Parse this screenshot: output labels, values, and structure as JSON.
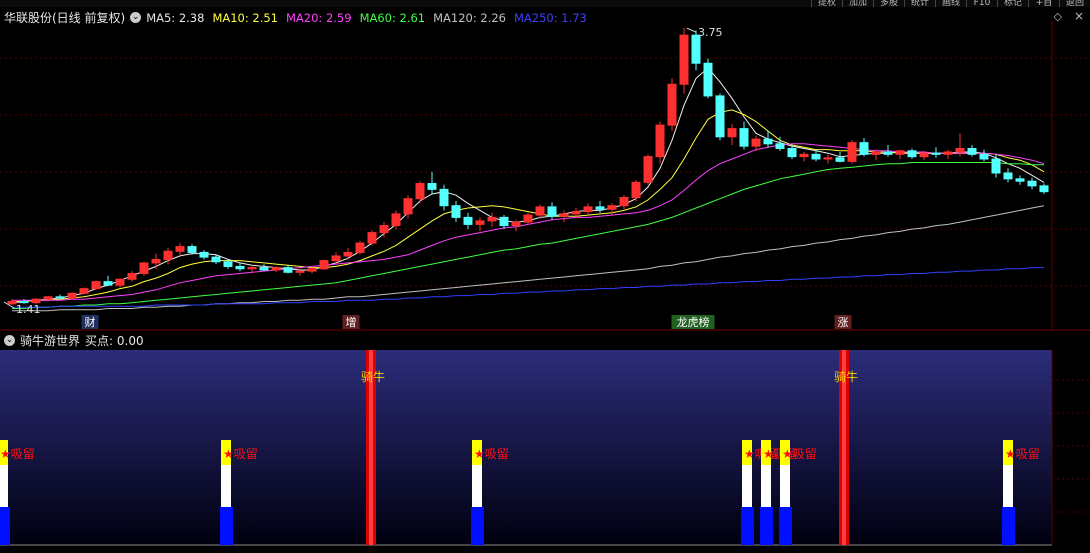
{
  "window": {
    "top_tabs_right": [
      "提权",
      "加加",
      "多股",
      "统计",
      "画线",
      "F10",
      "标记",
      "+自",
      "返回"
    ]
  },
  "main_panel": {
    "title": "华联股份(日线 前复权)",
    "ma_indicators": [
      {
        "label": "MA5: 2.38",
        "color": "#e6e6e6"
      },
      {
        "label": "MA10: 2.51",
        "color": "#ffff40"
      },
      {
        "label": "MA20: 2.59",
        "color": "#ff40ff"
      },
      {
        "label": "MA60: 2.61",
        "color": "#40ff40"
      },
      {
        "label": "MA120: 2.26",
        "color": "#c0c0c0"
      },
      {
        "label": "MA250: 1.73",
        "color": "#4040ff"
      }
    ],
    "high_label": "3.75",
    "low_label": "1.41",
    "date_markers": [
      {
        "text": "财",
        "color": "#ffffff",
        "bg": "#203060"
      },
      {
        "text": "增",
        "color": "#ffffff",
        "bg": "#602020"
      },
      {
        "text": "龙虎榜",
        "color": "#ffffff",
        "bg": "#206020"
      },
      {
        "text": "涨",
        "color": "#ffffff",
        "bg": "#602020"
      }
    ]
  },
  "sub_panel": {
    "title": "骑牛游世界",
    "buy_label": "买点: 0.00",
    "signal_bull": "骑牛",
    "signal_absorb": "★吸留",
    "colors": {
      "background_top": "#2c2c7a",
      "background_bottom": "#000010",
      "bull_bar": "#e00000",
      "absorb_yellow": "#ffff00",
      "absorb_white": "#ffffff",
      "absorb_blue": "#0010ff",
      "text": "#ff1010"
    }
  },
  "chart_data": {
    "type": "candlestick",
    "y_range": [
      1.35,
      3.85
    ],
    "ohlc": [
      [
        1.42,
        1.46,
        1.41,
        1.44
      ],
      [
        1.44,
        1.46,
        1.42,
        1.43
      ],
      [
        1.43,
        1.47,
        1.42,
        1.46
      ],
      [
        1.46,
        1.49,
        1.44,
        1.48
      ],
      [
        1.48,
        1.5,
        1.46,
        1.47
      ],
      [
        1.47,
        1.52,
        1.46,
        1.51
      ],
      [
        1.51,
        1.56,
        1.5,
        1.55
      ],
      [
        1.55,
        1.62,
        1.54,
        1.61
      ],
      [
        1.61,
        1.66,
        1.57,
        1.58
      ],
      [
        1.58,
        1.64,
        1.56,
        1.63
      ],
      [
        1.63,
        1.7,
        1.61,
        1.68
      ],
      [
        1.68,
        1.78,
        1.66,
        1.77
      ],
      [
        1.77,
        1.85,
        1.72,
        1.8
      ],
      [
        1.8,
        1.9,
        1.76,
        1.87
      ],
      [
        1.87,
        1.94,
        1.83,
        1.91
      ],
      [
        1.91,
        1.93,
        1.84,
        1.86
      ],
      [
        1.86,
        1.88,
        1.8,
        1.82
      ],
      [
        1.82,
        1.84,
        1.76,
        1.78
      ],
      [
        1.78,
        1.8,
        1.72,
        1.74
      ],
      [
        1.74,
        1.77,
        1.7,
        1.72
      ],
      [
        1.72,
        1.75,
        1.68,
        1.73
      ],
      [
        1.73,
        1.76,
        1.7,
        1.71
      ],
      [
        1.71,
        1.74,
        1.69,
        1.73
      ],
      [
        1.73,
        1.75,
        1.68,
        1.69
      ],
      [
        1.69,
        1.72,
        1.66,
        1.7
      ],
      [
        1.7,
        1.74,
        1.68,
        1.72
      ],
      [
        1.72,
        1.8,
        1.71,
        1.79
      ],
      [
        1.79,
        1.86,
        1.76,
        1.83
      ],
      [
        1.83,
        1.9,
        1.8,
        1.86
      ],
      [
        1.86,
        1.96,
        1.84,
        1.94
      ],
      [
        1.94,
        2.05,
        1.92,
        2.03
      ],
      [
        2.03,
        2.12,
        1.99,
        2.09
      ],
      [
        2.09,
        2.22,
        2.06,
        2.19
      ],
      [
        2.19,
        2.35,
        2.15,
        2.32
      ],
      [
        2.32,
        2.47,
        2.28,
        2.45
      ],
      [
        2.45,
        2.55,
        2.36,
        2.4
      ],
      [
        2.4,
        2.44,
        2.22,
        2.26
      ],
      [
        2.26,
        2.3,
        2.12,
        2.16
      ],
      [
        2.16,
        2.2,
        2.06,
        2.1
      ],
      [
        2.1,
        2.16,
        2.04,
        2.13
      ],
      [
        2.13,
        2.2,
        2.08,
        2.16
      ],
      [
        2.16,
        2.18,
        2.06,
        2.09
      ],
      [
        2.09,
        2.14,
        2.04,
        2.12
      ],
      [
        2.12,
        2.2,
        2.1,
        2.18
      ],
      [
        2.18,
        2.27,
        2.15,
        2.25
      ],
      [
        2.25,
        2.29,
        2.14,
        2.17
      ],
      [
        2.17,
        2.22,
        2.12,
        2.19
      ],
      [
        2.19,
        2.24,
        2.15,
        2.21
      ],
      [
        2.21,
        2.28,
        2.18,
        2.25
      ],
      [
        2.25,
        2.3,
        2.2,
        2.23
      ],
      [
        2.23,
        2.28,
        2.18,
        2.26
      ],
      [
        2.26,
        2.35,
        2.23,
        2.33
      ],
      [
        2.33,
        2.48,
        2.3,
        2.46
      ],
      [
        2.46,
        2.7,
        2.44,
        2.68
      ],
      [
        2.68,
        2.98,
        2.62,
        2.95
      ],
      [
        2.95,
        3.35,
        2.9,
        3.3
      ],
      [
        3.3,
        3.78,
        3.22,
        3.72
      ],
      [
        3.72,
        3.76,
        3.42,
        3.48
      ],
      [
        3.48,
        3.52,
        3.18,
        3.2
      ],
      [
        3.2,
        3.22,
        2.82,
        2.85
      ],
      [
        2.85,
        2.96,
        2.78,
        2.92
      ],
      [
        2.92,
        2.98,
        2.74,
        2.77
      ],
      [
        2.77,
        2.86,
        2.73,
        2.83
      ],
      [
        2.83,
        2.9,
        2.76,
        2.79
      ],
      [
        2.79,
        2.85,
        2.73,
        2.75
      ],
      [
        2.75,
        2.78,
        2.66,
        2.68
      ],
      [
        2.68,
        2.72,
        2.64,
        2.7
      ],
      [
        2.7,
        2.74,
        2.64,
        2.66
      ],
      [
        2.66,
        2.7,
        2.62,
        2.67
      ],
      [
        2.67,
        2.72,
        2.63,
        2.64
      ],
      [
        2.64,
        2.82,
        2.62,
        2.8
      ],
      [
        2.8,
        2.84,
        2.68,
        2.7
      ],
      [
        2.7,
        2.74,
        2.65,
        2.72
      ],
      [
        2.72,
        2.78,
        2.68,
        2.7
      ],
      [
        2.7,
        2.74,
        2.66,
        2.73
      ],
      [
        2.73,
        2.75,
        2.66,
        2.68
      ],
      [
        2.68,
        2.73,
        2.65,
        2.71
      ],
      [
        2.71,
        2.76,
        2.67,
        2.7
      ],
      [
        2.7,
        2.74,
        2.66,
        2.72
      ],
      [
        2.72,
        2.88,
        2.68,
        2.75
      ],
      [
        2.75,
        2.78,
        2.68,
        2.7
      ],
      [
        2.7,
        2.74,
        2.64,
        2.66
      ],
      [
        2.66,
        2.7,
        2.5,
        2.54
      ],
      [
        2.54,
        2.58,
        2.46,
        2.49
      ],
      [
        2.49,
        2.52,
        2.44,
        2.47
      ],
      [
        2.47,
        2.5,
        2.4,
        2.43
      ],
      [
        2.43,
        2.45,
        2.36,
        2.38
      ]
    ],
    "ma_series": [
      {
        "name": "MA5",
        "color": "#f0f0f0",
        "values": [
          1.43,
          1.44,
          1.45,
          1.46,
          1.47,
          1.49,
          1.51,
          1.55,
          1.58,
          1.62,
          1.66,
          1.7,
          1.74,
          1.79,
          1.83,
          1.85,
          1.85,
          1.84,
          1.8,
          1.77,
          1.75,
          1.74,
          1.73,
          1.72,
          1.71,
          1.71,
          1.74,
          1.77,
          1.81,
          1.87,
          1.94,
          2.02,
          2.1,
          2.2,
          2.3,
          2.36,
          2.38,
          2.35,
          2.28,
          2.22,
          2.16,
          2.13,
          2.12,
          2.13,
          2.16,
          2.17,
          2.19,
          2.21,
          2.22,
          2.22,
          2.24,
          2.27,
          2.32,
          2.42,
          2.58,
          2.82,
          3.12,
          3.35,
          3.44,
          3.32,
          3.18,
          3.02,
          2.88,
          2.83,
          2.8,
          2.77,
          2.75,
          2.73,
          2.71,
          2.68,
          2.69,
          2.7,
          2.71,
          2.71,
          2.72,
          2.71,
          2.71,
          2.71,
          2.71,
          2.72,
          2.72,
          2.71,
          2.67,
          2.62,
          2.58,
          2.52,
          2.46
        ]
      },
      {
        "name": "MA10",
        "color": "#ffff40",
        "values": [
          1.44,
          1.44,
          1.45,
          1.45,
          1.46,
          1.47,
          1.48,
          1.5,
          1.52,
          1.55,
          1.57,
          1.61,
          1.64,
          1.68,
          1.73,
          1.76,
          1.78,
          1.79,
          1.79,
          1.79,
          1.78,
          1.77,
          1.76,
          1.75,
          1.74,
          1.73,
          1.73,
          1.74,
          1.76,
          1.79,
          1.83,
          1.87,
          1.92,
          1.99,
          2.06,
          2.13,
          2.19,
          2.22,
          2.24,
          2.25,
          2.26,
          2.25,
          2.23,
          2.21,
          2.19,
          2.17,
          2.17,
          2.17,
          2.18,
          2.19,
          2.2,
          2.22,
          2.25,
          2.31,
          2.4,
          2.5,
          2.66,
          2.84,
          3.0,
          3.06,
          3.08,
          3.04,
          2.98,
          2.9,
          2.82,
          2.78,
          2.76,
          2.74,
          2.74,
          2.73,
          2.73,
          2.73,
          2.72,
          2.72,
          2.71,
          2.71,
          2.71,
          2.71,
          2.71,
          2.71,
          2.71,
          2.71,
          2.7,
          2.67,
          2.65,
          2.61,
          2.55
        ]
      },
      {
        "name": "MA20",
        "color": "#ff40ff",
        "values": [
          1.45,
          1.45,
          1.45,
          1.45,
          1.45,
          1.46,
          1.46,
          1.47,
          1.48,
          1.49,
          1.5,
          1.52,
          1.54,
          1.57,
          1.6,
          1.62,
          1.64,
          1.66,
          1.67,
          1.68,
          1.69,
          1.7,
          1.71,
          1.72,
          1.73,
          1.74,
          1.75,
          1.76,
          1.77,
          1.78,
          1.79,
          1.8,
          1.82,
          1.84,
          1.88,
          1.92,
          1.96,
          1.99,
          2.01,
          2.03,
          2.05,
          2.07,
          2.08,
          2.1,
          2.12,
          2.14,
          2.15,
          2.16,
          2.16,
          2.17,
          2.18,
          2.19,
          2.2,
          2.22,
          2.26,
          2.31,
          2.39,
          2.48,
          2.56,
          2.62,
          2.66,
          2.7,
          2.74,
          2.76,
          2.78,
          2.79,
          2.79,
          2.78,
          2.77,
          2.76,
          2.75,
          2.74,
          2.73,
          2.73,
          2.72,
          2.72,
          2.72,
          2.71,
          2.71,
          2.71,
          2.71,
          2.71,
          2.7,
          2.69,
          2.67,
          2.65,
          2.62
        ]
      },
      {
        "name": "MA60",
        "color": "#40ff40",
        "values": [
          1.38,
          1.38,
          1.39,
          1.39,
          1.4,
          1.4,
          1.41,
          1.41,
          1.42,
          1.42,
          1.43,
          1.44,
          1.45,
          1.46,
          1.47,
          1.48,
          1.49,
          1.5,
          1.51,
          1.52,
          1.53,
          1.54,
          1.55,
          1.56,
          1.57,
          1.58,
          1.59,
          1.6,
          1.62,
          1.64,
          1.66,
          1.68,
          1.7,
          1.72,
          1.74,
          1.76,
          1.78,
          1.8,
          1.82,
          1.84,
          1.86,
          1.88,
          1.89,
          1.91,
          1.93,
          1.94,
          1.96,
          1.98,
          2.0,
          2.02,
          2.04,
          2.06,
          2.08,
          2.1,
          2.13,
          2.16,
          2.2,
          2.24,
          2.28,
          2.32,
          2.36,
          2.4,
          2.43,
          2.46,
          2.49,
          2.51,
          2.53,
          2.55,
          2.57,
          2.58,
          2.59,
          2.6,
          2.61,
          2.62,
          2.62,
          2.63,
          2.63,
          2.63,
          2.63,
          2.63,
          2.63,
          2.63,
          2.63,
          2.62,
          2.62,
          2.61,
          2.61
        ]
      },
      {
        "name": "MA120",
        "color": "#c0c0c0",
        "values": [
          1.36,
          1.36,
          1.36,
          1.36,
          1.37,
          1.37,
          1.37,
          1.37,
          1.38,
          1.38,
          1.38,
          1.39,
          1.39,
          1.4,
          1.4,
          1.41,
          1.41,
          1.42,
          1.42,
          1.43,
          1.43,
          1.44,
          1.44,
          1.45,
          1.45,
          1.46,
          1.46,
          1.47,
          1.48,
          1.48,
          1.49,
          1.5,
          1.51,
          1.52,
          1.53,
          1.54,
          1.55,
          1.56,
          1.57,
          1.58,
          1.59,
          1.6,
          1.61,
          1.62,
          1.63,
          1.64,
          1.65,
          1.66,
          1.67,
          1.68,
          1.69,
          1.7,
          1.71,
          1.72,
          1.74,
          1.75,
          1.77,
          1.78,
          1.8,
          1.82,
          1.83,
          1.85,
          1.86,
          1.88,
          1.89,
          1.91,
          1.92,
          1.94,
          1.95,
          1.97,
          1.98,
          2.0,
          2.01,
          2.03,
          2.04,
          2.06,
          2.07,
          2.09,
          2.1,
          2.12,
          2.14,
          2.16,
          2.18,
          2.2,
          2.22,
          2.24,
          2.26
        ]
      },
      {
        "name": "MA250",
        "color": "#3040ff",
        "values": [
          1.39,
          1.39,
          1.39,
          1.39,
          1.4,
          1.4,
          1.4,
          1.4,
          1.4,
          1.4,
          1.4,
          1.4,
          1.41,
          1.41,
          1.41,
          1.41,
          1.41,
          1.42,
          1.42,
          1.42,
          1.42,
          1.42,
          1.43,
          1.43,
          1.43,
          1.44,
          1.44,
          1.44,
          1.45,
          1.45,
          1.45,
          1.46,
          1.46,
          1.47,
          1.47,
          1.48,
          1.48,
          1.49,
          1.49,
          1.5,
          1.5,
          1.51,
          1.51,
          1.52,
          1.52,
          1.53,
          1.53,
          1.54,
          1.54,
          1.55,
          1.55,
          1.56,
          1.56,
          1.57,
          1.57,
          1.58,
          1.58,
          1.59,
          1.59,
          1.6,
          1.6,
          1.61,
          1.61,
          1.62,
          1.62,
          1.63,
          1.63,
          1.64,
          1.64,
          1.65,
          1.65,
          1.66,
          1.66,
          1.67,
          1.67,
          1.68,
          1.68,
          1.69,
          1.69,
          1.7,
          1.7,
          1.71,
          1.71,
          1.72,
          1.72,
          1.73,
          1.73
        ]
      }
    ],
    "bull_signals_at": [
      31,
      71
    ],
    "absorb_signals_at": [
      0,
      12,
      26,
      41,
      42,
      43,
      58
    ]
  }
}
